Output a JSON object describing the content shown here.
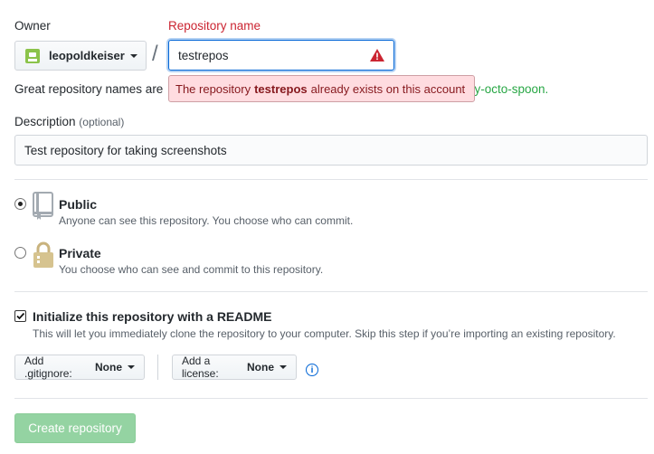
{
  "owner": {
    "label": "Owner",
    "name": "leopoldkeiser"
  },
  "repo": {
    "label": "Repository name",
    "value": "testrepos",
    "separator": "/"
  },
  "hint": {
    "prefix": "Great repository names are",
    "suffix": "rly-octo-spoon."
  },
  "error": {
    "before": "The repository",
    "repo": "testrepos",
    "after": "already exists on this account"
  },
  "description": {
    "label": "Description",
    "optional": "(optional)",
    "value": "Test repository for taking screenshots"
  },
  "visibility": {
    "public": {
      "title": "Public",
      "note": "Anyone can see this repository. You choose who can commit.",
      "checked": true
    },
    "private": {
      "title": "Private",
      "note": "You choose who can see and commit to this repository.",
      "checked": false
    }
  },
  "readme": {
    "title": "Initialize this repository with a README",
    "note": "This will let you immediately clone the repository to your computer. Skip this step if you’re importing an existing repository.",
    "checked": true
  },
  "gitignore": {
    "label": "Add .gitignore:",
    "value": "None"
  },
  "license": {
    "label": "Add a license:",
    "value": "None"
  },
  "create_button": "Create repository",
  "colors": {
    "accent": "#0366d6",
    "error": "#cb2431",
    "success_disabled": "#94d3a2"
  }
}
